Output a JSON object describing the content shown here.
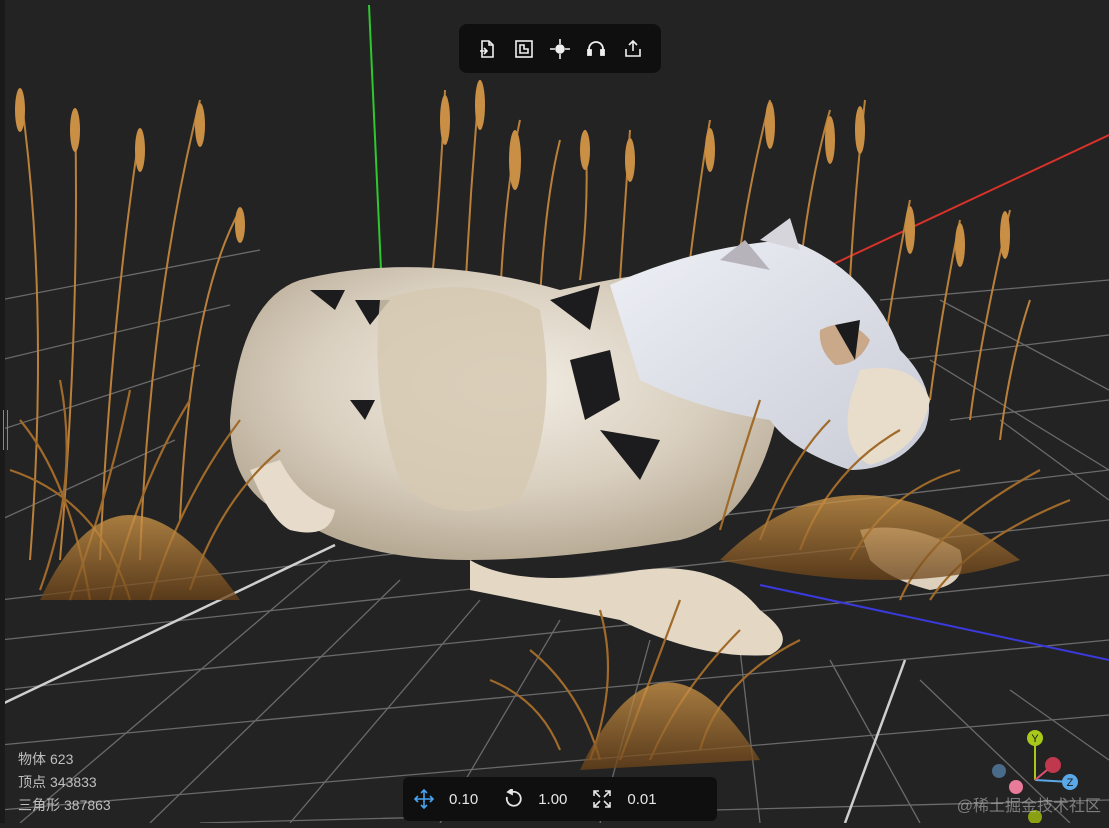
{
  "top_toolbar": {
    "icons": [
      "import-file-icon",
      "puzzle-icon",
      "focus-crosshair-icon",
      "headset-icon",
      "share-icon"
    ]
  },
  "stats": {
    "objects": {
      "label": "物体",
      "value": "623"
    },
    "vertices": {
      "label": "顶点",
      "value": "343833"
    },
    "triangles": {
      "label": "三角形",
      "value": "387863"
    }
  },
  "transform_toolbar": {
    "move": {
      "icon": "move-arrows-icon",
      "value": "0.10"
    },
    "rotate": {
      "icon": "rotate-icon",
      "value": "1.00"
    },
    "scale": {
      "icon": "scale-expand-icon",
      "value": "0.01"
    }
  },
  "gizmo": {
    "x_color": "#e0506e",
    "y_color": "#a8c81a",
    "z_color": "#5aa8e8",
    "y_label": "Y",
    "z_label": "Z"
  },
  "axis_colors": {
    "x": "#d8322a",
    "y": "#2ec82e",
    "z": "#3a3adc"
  },
  "watermark": "@稀土掘金技术社区"
}
